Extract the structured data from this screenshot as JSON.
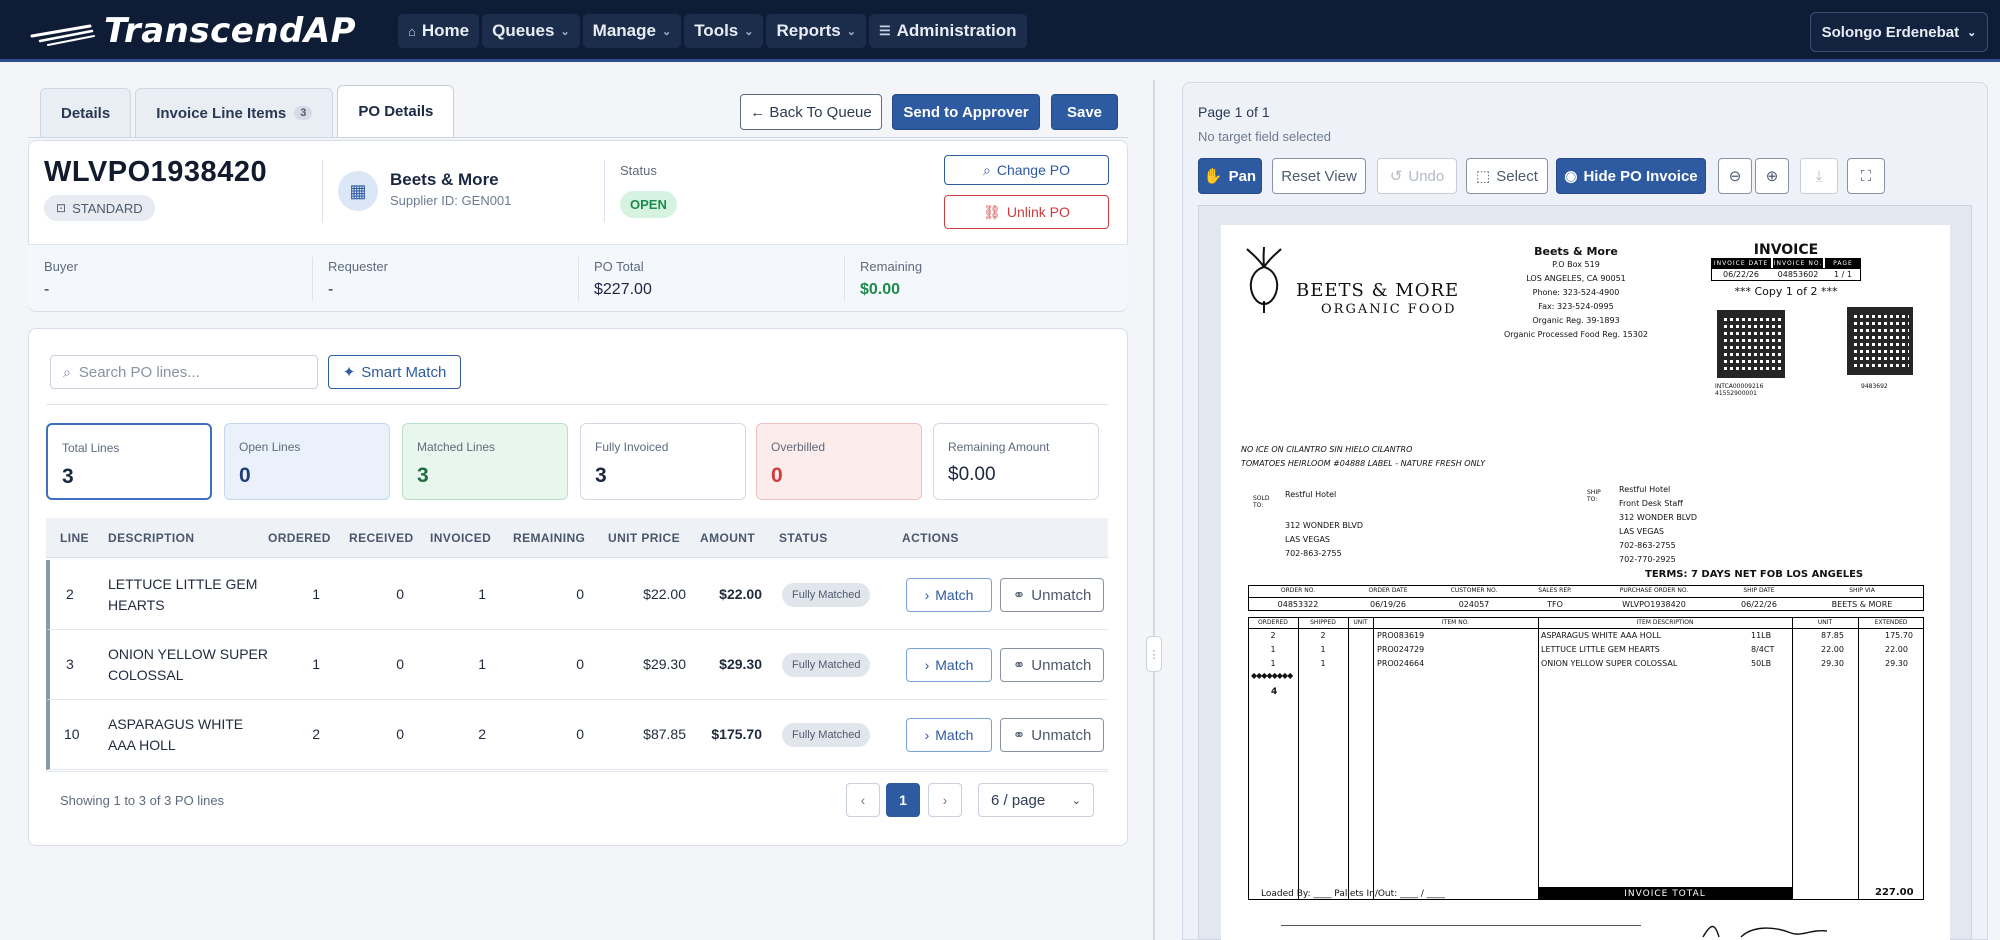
{
  "app": {
    "brand": "TranscendAP",
    "nav": [
      {
        "label": "Home",
        "icon": "home-icon"
      },
      {
        "label": "Queues",
        "icon": "chevron-down-icon"
      },
      {
        "label": "Manage",
        "icon": "chevron-down-icon"
      },
      {
        "label": "Tools",
        "icon": "chevron-down-icon"
      },
      {
        "label": "Reports",
        "icon": "chevron-down-icon"
      },
      {
        "label": "Administration",
        "icon": "sliders-icon"
      }
    ],
    "user": "Solongo Erdenebat"
  },
  "tabs": {
    "details": "Details",
    "line_items": "Invoice Line Items",
    "line_items_count": "3",
    "po_details": "PO Details"
  },
  "actions": {
    "back": "← Back To Queue",
    "send": "Send to Approver",
    "save": "Save"
  },
  "po": {
    "number": "WLVPO1938420",
    "type": "STANDARD",
    "supplier_name": "Beets & More",
    "supplier_id": "Supplier ID: GEN001",
    "status_label": "Status",
    "status": "OPEN",
    "change_po": "Change PO",
    "unlink_po": "Unlink PO",
    "buyer_label": "Buyer",
    "buyer": "-",
    "requester_label": "Requester",
    "requester": "-",
    "total_label": "PO Total",
    "total": "$227.00",
    "remaining_label": "Remaining",
    "remaining": "$0.00"
  },
  "search": {
    "placeholder": "Search PO lines...",
    "smart_match": "Smart Match"
  },
  "stats": [
    {
      "label": "Total Lines",
      "value": "3"
    },
    {
      "label": "Open Lines",
      "value": "0"
    },
    {
      "label": "Matched Lines",
      "value": "3"
    },
    {
      "label": "Fully Invoiced",
      "value": "3"
    },
    {
      "label": "Overbilled",
      "value": "0"
    },
    {
      "label": "Remaining Amount",
      "value": "$0.00"
    }
  ],
  "table": {
    "headers": [
      "LINE",
      "DESCRIPTION",
      "ORDERED",
      "RECEIVED",
      "INVOICED",
      "REMAINING",
      "UNIT PRICE",
      "AMOUNT",
      "STATUS",
      "ACTIONS"
    ],
    "rows": [
      {
        "line": "2",
        "description": "LETTUCE LITTLE GEM HEARTS",
        "ordered": "1",
        "received": "0",
        "invoiced": "1",
        "remaining": "0",
        "unit_price": "$22.00",
        "amount": "$22.00",
        "status": "Fully Matched",
        "match": "Match",
        "unmatch": "Unmatch"
      },
      {
        "line": "3",
        "description": "ONION YELLOW SUPER COLOSSAL",
        "ordered": "1",
        "received": "0",
        "invoiced": "1",
        "remaining": "0",
        "unit_price": "$29.30",
        "amount": "$29.30",
        "status": "Fully Matched",
        "match": "Match",
        "unmatch": "Unmatch"
      },
      {
        "line": "10",
        "description": "ASPARAGUS WHITE AAA HOLL",
        "ordered": "2",
        "received": "0",
        "invoiced": "2",
        "remaining": "0",
        "unit_price": "$87.85",
        "amount": "$175.70",
        "status": "Fully Matched",
        "match": "Match",
        "unmatch": "Unmatch"
      }
    ],
    "showing": "Showing 1 to 3 of 3 PO lines",
    "current_page": "1",
    "page_size": "6 / page"
  },
  "viewer": {
    "page_info": "Page 1 of 1",
    "target_info": "No target field selected",
    "pan": "Pan",
    "reset_view": "Reset View",
    "undo": "Undo",
    "select": "Select",
    "hide_po": "Hide PO Invoice"
  },
  "invoice": {
    "vendor_logo_line1": "BEETS & MORE",
    "vendor_logo_line2": "ORGANIC FOOD",
    "vendor_name": "Beets & More",
    "address": [
      "P.O Box 519",
      "LOS ANGELES, CA 90051",
      "Phone: 323-524-4900",
      "Fax: 323-524-0995",
      "Organic Reg. 39-1893",
      "Organic Processed Food Reg. 15302"
    ],
    "title": "INVOICE",
    "hdr_cells": [
      "INVOICE DATE",
      "INVOICE NO.",
      "PAGE"
    ],
    "hdr_values": [
      "06/22/26",
      "04853602",
      "1 / 1"
    ],
    "copy": "*** Copy 1 of 2 ***",
    "qr_caption_left": "INTCA00009216 41552900001",
    "qr_caption_right": "9483692",
    "notes": [
      "NO ICE ON CILANTRO SIN HIELO CILANTRO",
      "TOMATOES HEIRLOOM #04888 LABEL - NATURE FRESH ONLY"
    ],
    "sold_label": "SOLD TO:",
    "sold_to": [
      "Restful Hotel",
      "312 WONDER BLVD",
      "LAS VEGAS",
      "702-863-2755"
    ],
    "ship_label": "SHIP TO:",
    "ship_to": [
      "Restful Hotel",
      "Front Desk Staff",
      "312 WONDER BLVD",
      "LAS VEGAS",
      "702-863-2755",
      "702-770-2925"
    ],
    "terms": "TERMS: 7 DAYS NET FOB LOS ANGELES",
    "order_headers": [
      "ORDER NO.",
      "ORDER DATE",
      "CUSTOMER NO.",
      "SALES REP.",
      "PURCHASE ORDER NO.",
      "SHIP DATE",
      "SHIP VIA"
    ],
    "order_values": [
      "04853322",
      "06/19/26",
      "024057",
      "TFO",
      "WLVPO1938420",
      "06/22/26",
      "BEETS & MORE"
    ],
    "line_headers": [
      "ORDERED",
      "SHIPPED",
      "UNIT",
      "ITEM NO.",
      "ITEM DESCRIPTION",
      "UNIT",
      "EXTENDED"
    ],
    "lines": [
      {
        "ordered": "2",
        "shipped": "2",
        "item": "PRO083619",
        "desc": "ASPARAGUS WHITE AAA HOLL",
        "size": "11LB",
        "unit": "87.85",
        "ext": "175.70"
      },
      {
        "ordered": "1",
        "shipped": "1",
        "item": "PRO024729",
        "desc": "LETTUCE LITTLE GEM HEARTS",
        "size": "8/4CT",
        "unit": "22.00",
        "ext": "22.00"
      },
      {
        "ordered": "1",
        "shipped": "1",
        "item": "PRO024664",
        "desc": "ONION YELLOW SUPER COLOSSAL",
        "size": "50LB",
        "unit": "29.30",
        "ext": "29.30"
      }
    ],
    "count_marker": "4",
    "loaded_by": "Loaded By: ____   Pallets In/Out: ____ / ____",
    "invoice_total_label": "INVOICE TOTAL",
    "invoice_total": "227.00"
  }
}
